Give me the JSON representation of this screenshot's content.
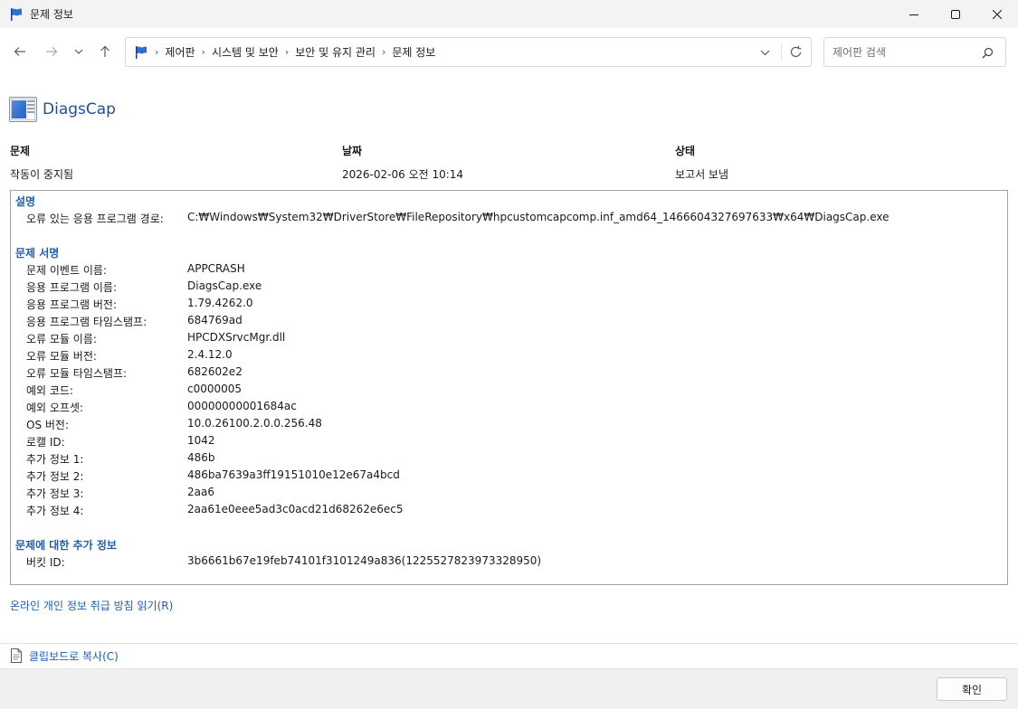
{
  "window": {
    "title": "문제 정보",
    "controls": [
      "minimize-icon",
      "maximize-icon",
      "close-icon"
    ]
  },
  "nav": {
    "back": "arrow-left-icon",
    "forward": "arrow-right-icon",
    "recent": "chevron-down-icon",
    "up": "arrow-up-icon"
  },
  "breadcrumb": {
    "items": [
      "제어판",
      "시스템 및 보안",
      "보안 및 유지 관리",
      "문제 정보"
    ]
  },
  "search": {
    "placeholder": "제어판 검색"
  },
  "header": {
    "app_name": "DiagsCap"
  },
  "summary": {
    "problem_label": "문제",
    "problem_value": "작동이 중지됨",
    "date_label": "날짜",
    "date_value": "2026-02-06 오전 10:14",
    "status_label": "상태",
    "status_value": "보고서 보냄"
  },
  "details": {
    "description": {
      "title": "설명",
      "rows": [
        {
          "k": "오류 있는 응용 프로그램 경로:",
          "v": "C:₩Windows₩System32₩DriverStore₩FileRepository₩hpcustomcapcomp.inf_amd64_1466604327697633₩x64₩DiagsCap.exe"
        }
      ]
    },
    "signature": {
      "title": "문제 서명",
      "rows": [
        {
          "k": "문제 이벤트 이름:",
          "v": "APPCRASH"
        },
        {
          "k": "응용 프로그램 이름:",
          "v": "DiagsCap.exe"
        },
        {
          "k": "응용 프로그램 버전:",
          "v": "1.79.4262.0"
        },
        {
          "k": "응용 프로그램 타임스탬프:",
          "v": "684769ad"
        },
        {
          "k": "오류 모듈 이름:",
          "v": "HPCDXSrvcMgr.dll"
        },
        {
          "k": "오류 모듈 버전:",
          "v": "2.4.12.0"
        },
        {
          "k": "오류 모듈 타임스탬프:",
          "v": "682602e2"
        },
        {
          "k": "예외 코드:",
          "v": "c0000005"
        },
        {
          "k": "예외 오프셋:",
          "v": "00000000001684ac"
        },
        {
          "k": "OS 버전:",
          "v": "10.0.26100.2.0.0.256.48"
        },
        {
          "k": "로캘 ID:",
          "v": "1042"
        },
        {
          "k": "추가 정보 1:",
          "v": "486b"
        },
        {
          "k": "추가 정보 2:",
          "v": "486ba7639a3ff19151010e12e67a4bcd"
        },
        {
          "k": "추가 정보 3:",
          "v": "2aa6"
        },
        {
          "k": "추가 정보 4:",
          "v": "2aa61e0eee5ad3c0acd21d68262e6ec5"
        }
      ]
    },
    "extra": {
      "title": "문제에 대한 추가 정보",
      "rows": [
        {
          "k": "버킷 ID:",
          "v": "3b6661b67e19feb74101f3101249a836(1225527823973328950)"
        }
      ]
    }
  },
  "links": {
    "privacy": "온라인 개인 정보 취급 방침 읽기(R)",
    "copy": "클립보드로 복사(C)"
  },
  "footer": {
    "ok": "확인"
  },
  "colors": {
    "link": "#1f5fb1",
    "app_title": "#1d4f9c",
    "titlebar_bg": "#f3f3f3",
    "footer_bg": "#f0f0f0"
  }
}
